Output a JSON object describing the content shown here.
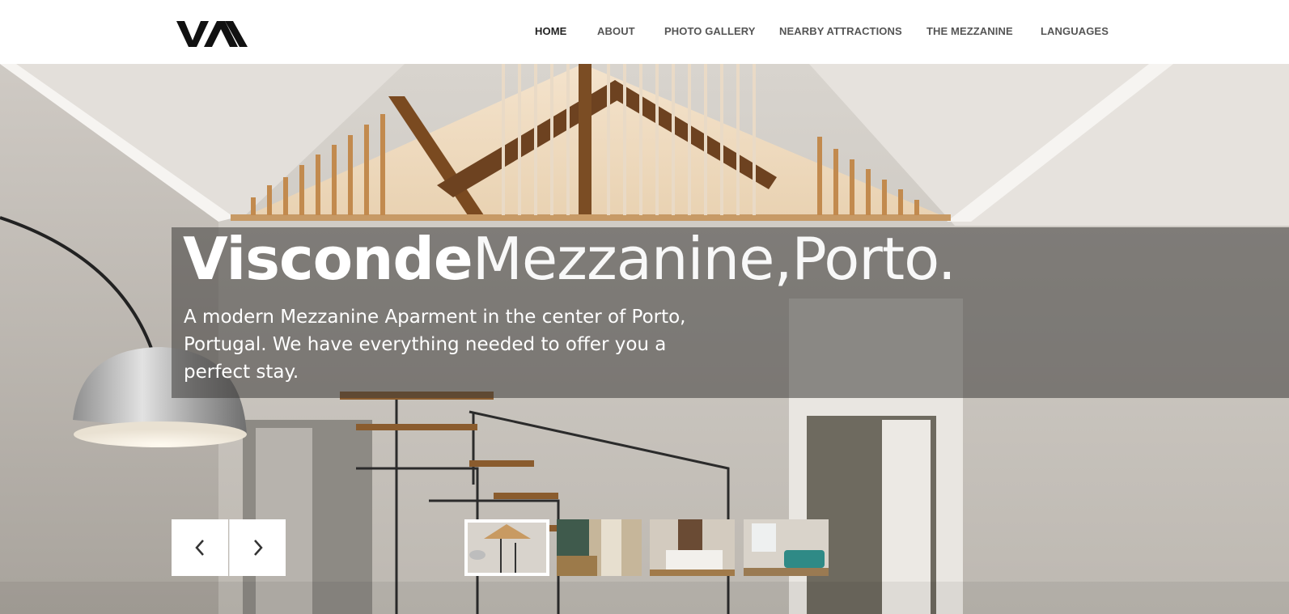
{
  "brand": {
    "logo_text": "VA"
  },
  "nav": {
    "items": [
      {
        "label": "HOME",
        "active": true
      },
      {
        "label": "ABOUT"
      },
      {
        "label": "PHOTO GALLERY"
      },
      {
        "label": "NEARBY ATTRACTIONS"
      },
      {
        "label": "THE MEZZANINE"
      },
      {
        "label": "LANGUAGES"
      }
    ]
  },
  "hero": {
    "title_bold": "Visconde",
    "title_light": "Mezzanine,Porto.",
    "subtitle": "A modern Mezzanine Aparment in the center of Porto, Portugal. We have everything needed to offer you a perfect stay."
  },
  "slider": {
    "prev_icon": "chevron-left-icon",
    "next_icon": "chevron-right-icon",
    "active_thumb": 1,
    "thumb_count": 4
  },
  "colors": {
    "nav_text": "#555555",
    "nav_active": "#222222",
    "caption_overlay": "rgba(60,58,56,0.55)"
  }
}
